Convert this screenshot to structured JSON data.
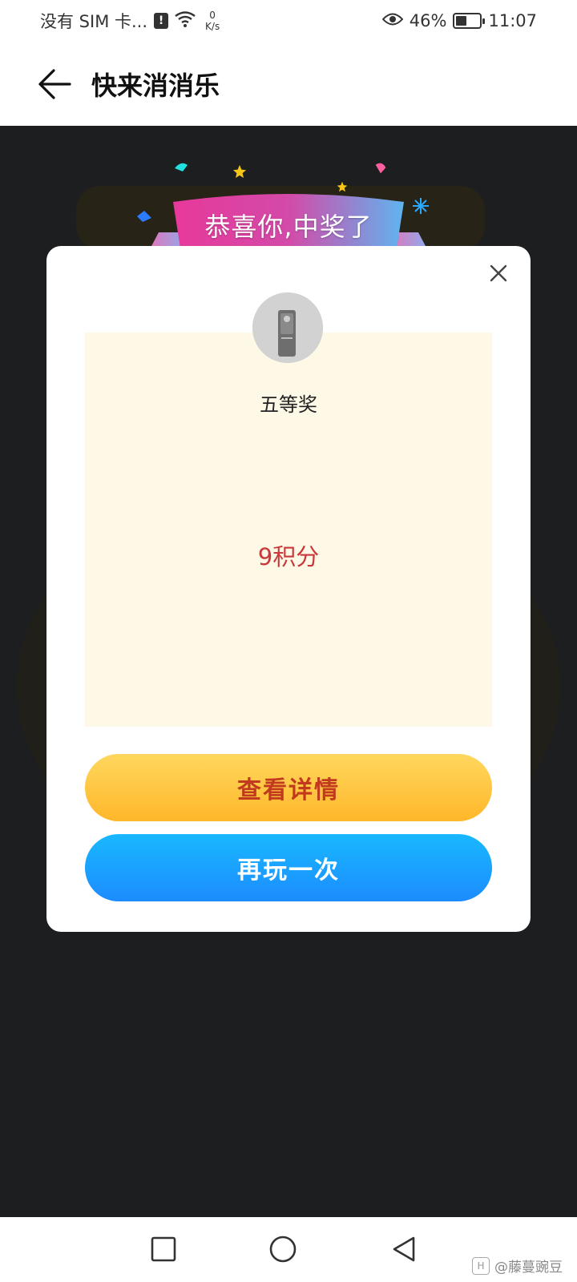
{
  "status_bar": {
    "carrier": "没有 SIM 卡...",
    "speed_value": "0",
    "speed_unit": "K/s",
    "battery_percent": "46%",
    "battery_level": 0.46,
    "time": "11:07"
  },
  "header": {
    "title": "快来消消乐"
  },
  "ribbon": {
    "text": "恭喜你,中奖了"
  },
  "prize": {
    "level": "五等奖",
    "amount": "9积分"
  },
  "buttons": {
    "details": "查看详情",
    "replay": "再玩一次"
  },
  "watermark": {
    "text": "@藤蔓豌豆"
  },
  "colors": {
    "details_bg": "#ffc43f",
    "details_text": "#c23a1e",
    "replay_bg": "#1ba2ff",
    "amount_text": "#c9383b",
    "panel_bg": "#fdf9e6"
  }
}
